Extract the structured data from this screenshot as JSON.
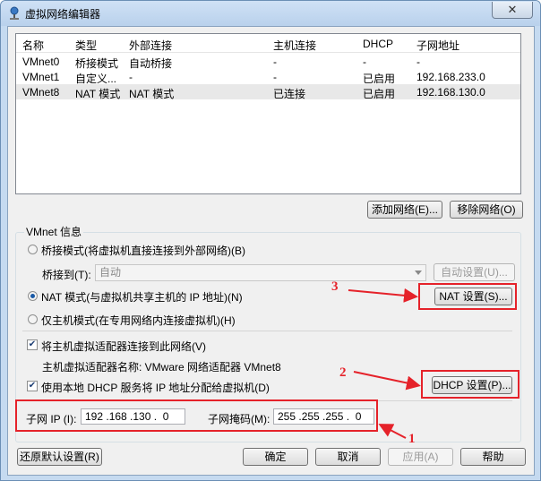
{
  "window": {
    "title": "虚拟网络编辑器",
    "close_glyph": "✕"
  },
  "network_table": {
    "headers": [
      "名称",
      "类型",
      "外部连接",
      "主机连接",
      "DHCP",
      "子网地址"
    ],
    "rows": [
      [
        "VMnet0",
        "桥接模式",
        "自动桥接",
        "-",
        "-",
        "-"
      ],
      [
        "VMnet1",
        "自定义...",
        "-",
        "-",
        "已启用",
        "192.168.233.0"
      ],
      [
        "VMnet8",
        "NAT 模式",
        "NAT 模式",
        "已连接",
        "已启用",
        "192.168.130.0"
      ]
    ]
  },
  "table_buttons": {
    "add_network": "添加网络(E)...",
    "remove_network": "移除网络(O)"
  },
  "vmnet_info": {
    "group_label": "VMnet 信息",
    "bridged_radio": "桥接模式(将虚拟机直接连接到外部网络)(B)",
    "bridged_to_label": "桥接到(T):",
    "bridged_to_value": "自动",
    "auto_settings": "自动设置(U)...",
    "nat_radio": "NAT 模式(与虚拟机共享主机的 IP 地址)(N)",
    "nat_settings": "NAT 设置(S)...",
    "hostonly_radio": "仅主机模式(在专用网络内连接虚拟机)(H)",
    "connect_adapter_check": "将主机虚拟适配器连接到此网络(V)",
    "adapter_name": "主机虚拟适配器名称: VMware 网络适配器 VMnet8",
    "dhcp_check": "使用本地 DHCP 服务将 IP 地址分配给虚拟机(D)",
    "dhcp_settings": "DHCP 设置(P)...",
    "subnet_ip_label": "子网 IP (I):",
    "subnet_ip_value": "192 .168 .130 .  0",
    "subnet_mask_label": "子网掩码(M):",
    "subnet_mask_value": "255 .255 .255 .  0",
    "check_glyph": "✔"
  },
  "footer": {
    "restore_defaults": "还原默认设置(R)",
    "ok": "确定",
    "cancel": "取消",
    "apply": "应用(A)",
    "help": "帮助"
  },
  "annotations": {
    "label_1": "1",
    "label_2": "2",
    "label_3": "3",
    "color": "#e5222a"
  }
}
